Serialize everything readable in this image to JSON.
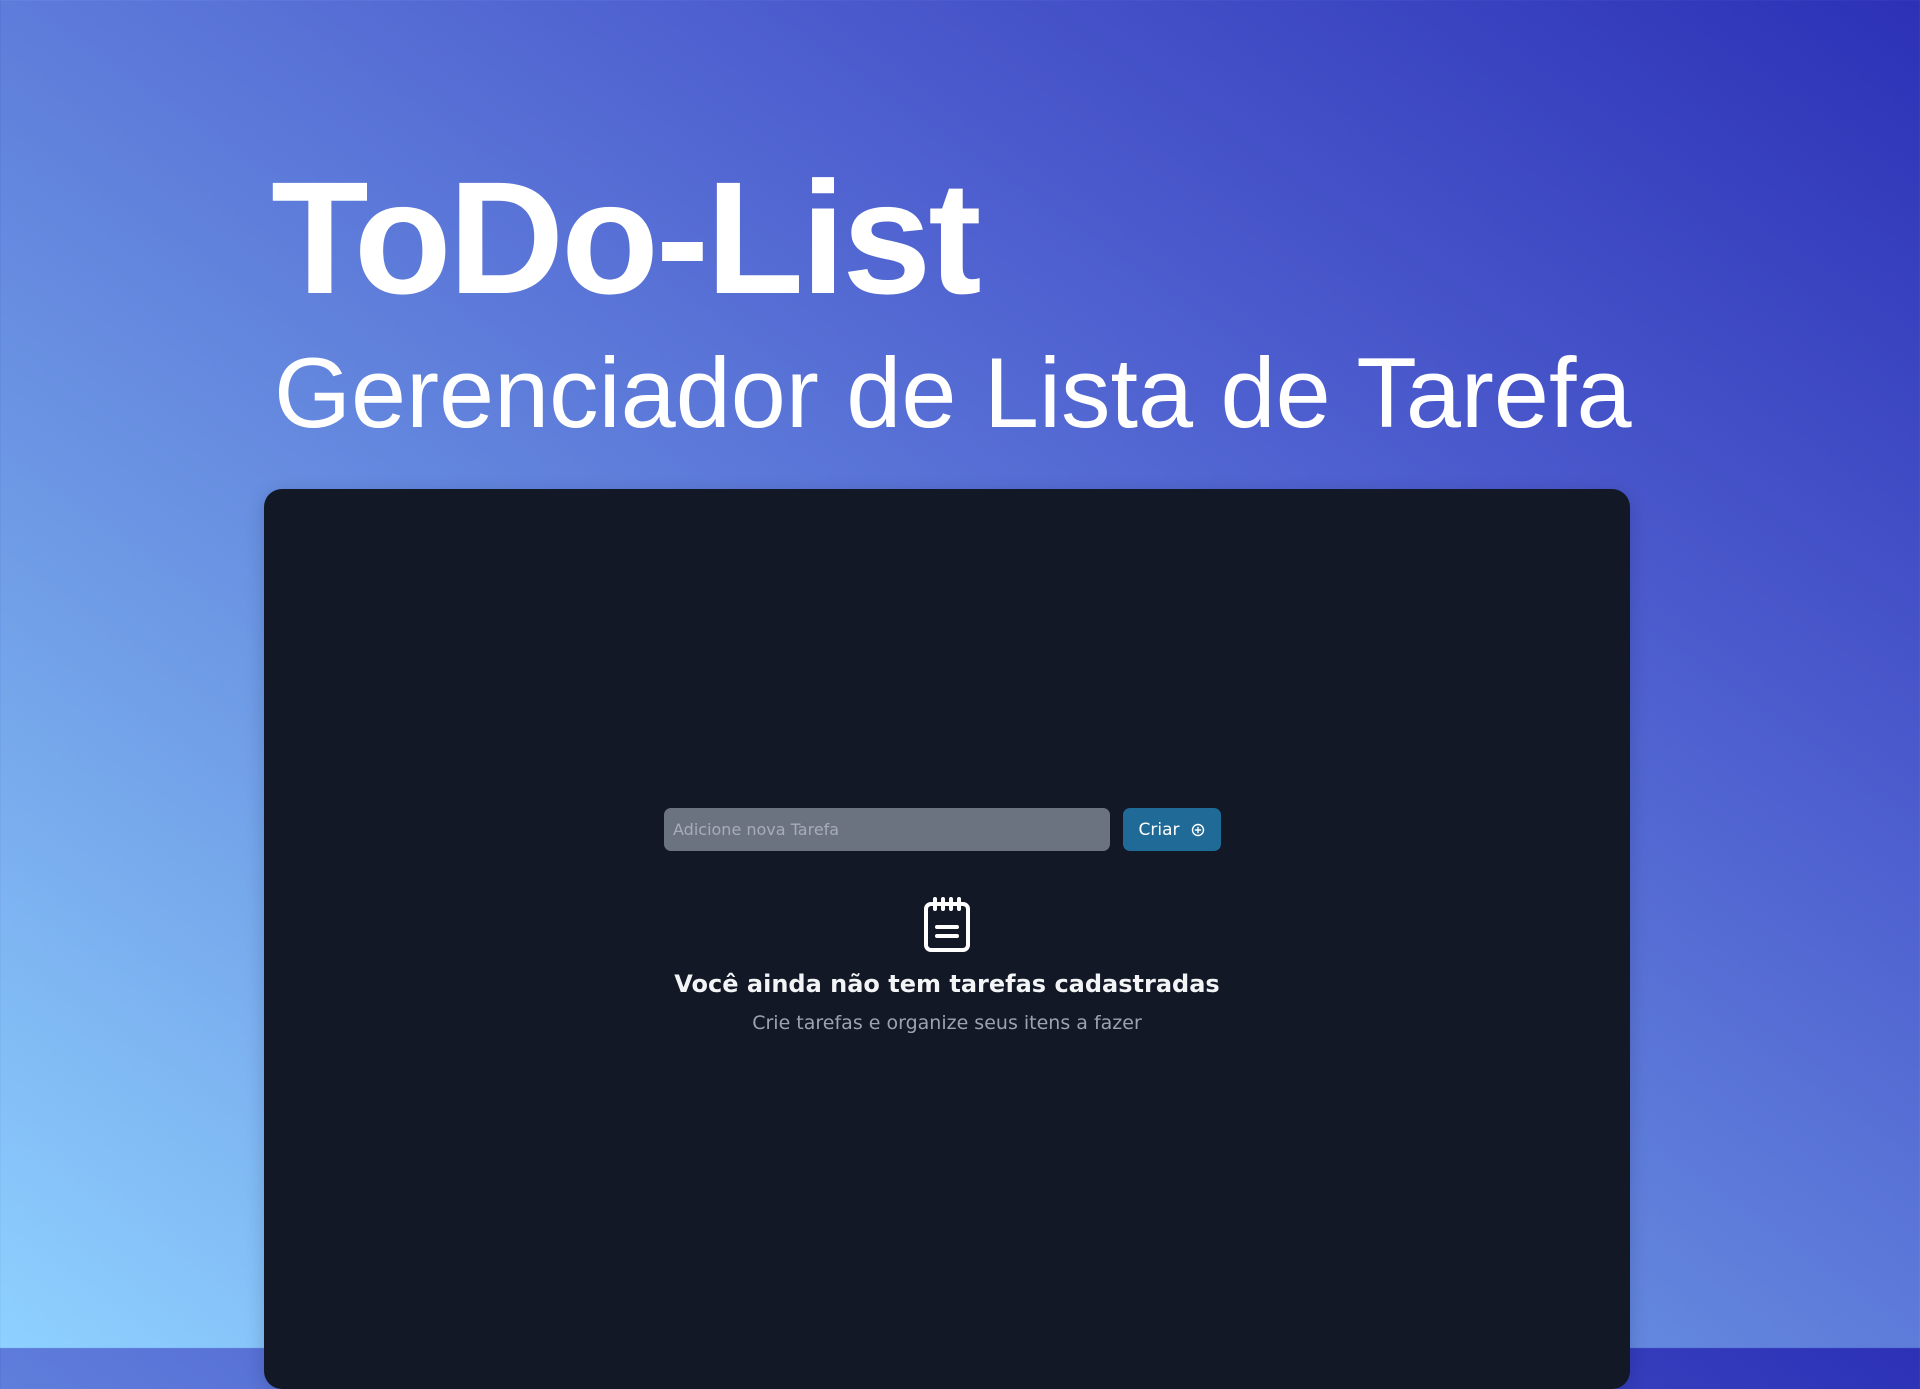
{
  "hero": {
    "title": "ToDo-List",
    "subtitle": "Gerenciador de Lista de Tarefa"
  },
  "form": {
    "input_placeholder": "Adicione nova Tarefa",
    "input_value": "",
    "create_label": "Criar",
    "create_icon": "plus-circle-icon"
  },
  "empty_state": {
    "icon": "notepad-icon",
    "title": "Você ainda não tem tarefas cadastradas",
    "subtitle": "Crie tarefas e organize seus itens a fazer"
  },
  "colors": {
    "gradient_light": "#8ed1ff",
    "gradient_dark": "#2c31b6",
    "panel_background": "#121826",
    "input_background": "#6b7280",
    "button_background": "#1f6a97",
    "muted_text": "#9ca3af"
  }
}
